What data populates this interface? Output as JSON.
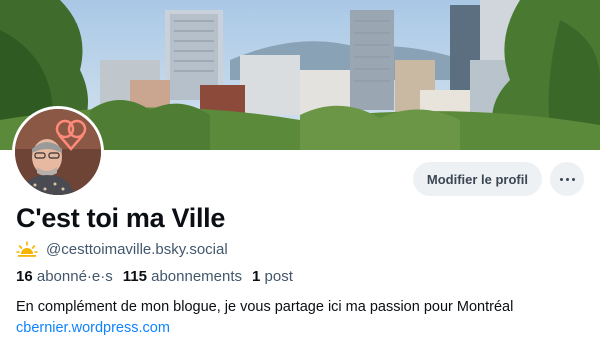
{
  "profile": {
    "display_name": "C'est toi ma Ville",
    "handle": "@cesttoimaville.bsky.social",
    "stats": {
      "followers_count": "16",
      "followers_label": "abonné·e·s",
      "following_count": "115",
      "following_label": "abonnements",
      "posts_count": "1",
      "posts_label": "post"
    },
    "bio": "En complément de mon blogue, je vous partage ici ma passion pour Montréal",
    "link": "cbernier.wordpress.com"
  },
  "actions": {
    "edit_label": "Modifier le profil",
    "more_icon": "ellipsis-icon"
  },
  "icons": {
    "handle_badge": "sun-icon",
    "banner": "city-skyline-photo",
    "avatar": "profile-photo"
  },
  "colors": {
    "link": "#1083fe",
    "muted_text": "#42576c",
    "button_bg": "#eef1f4"
  }
}
